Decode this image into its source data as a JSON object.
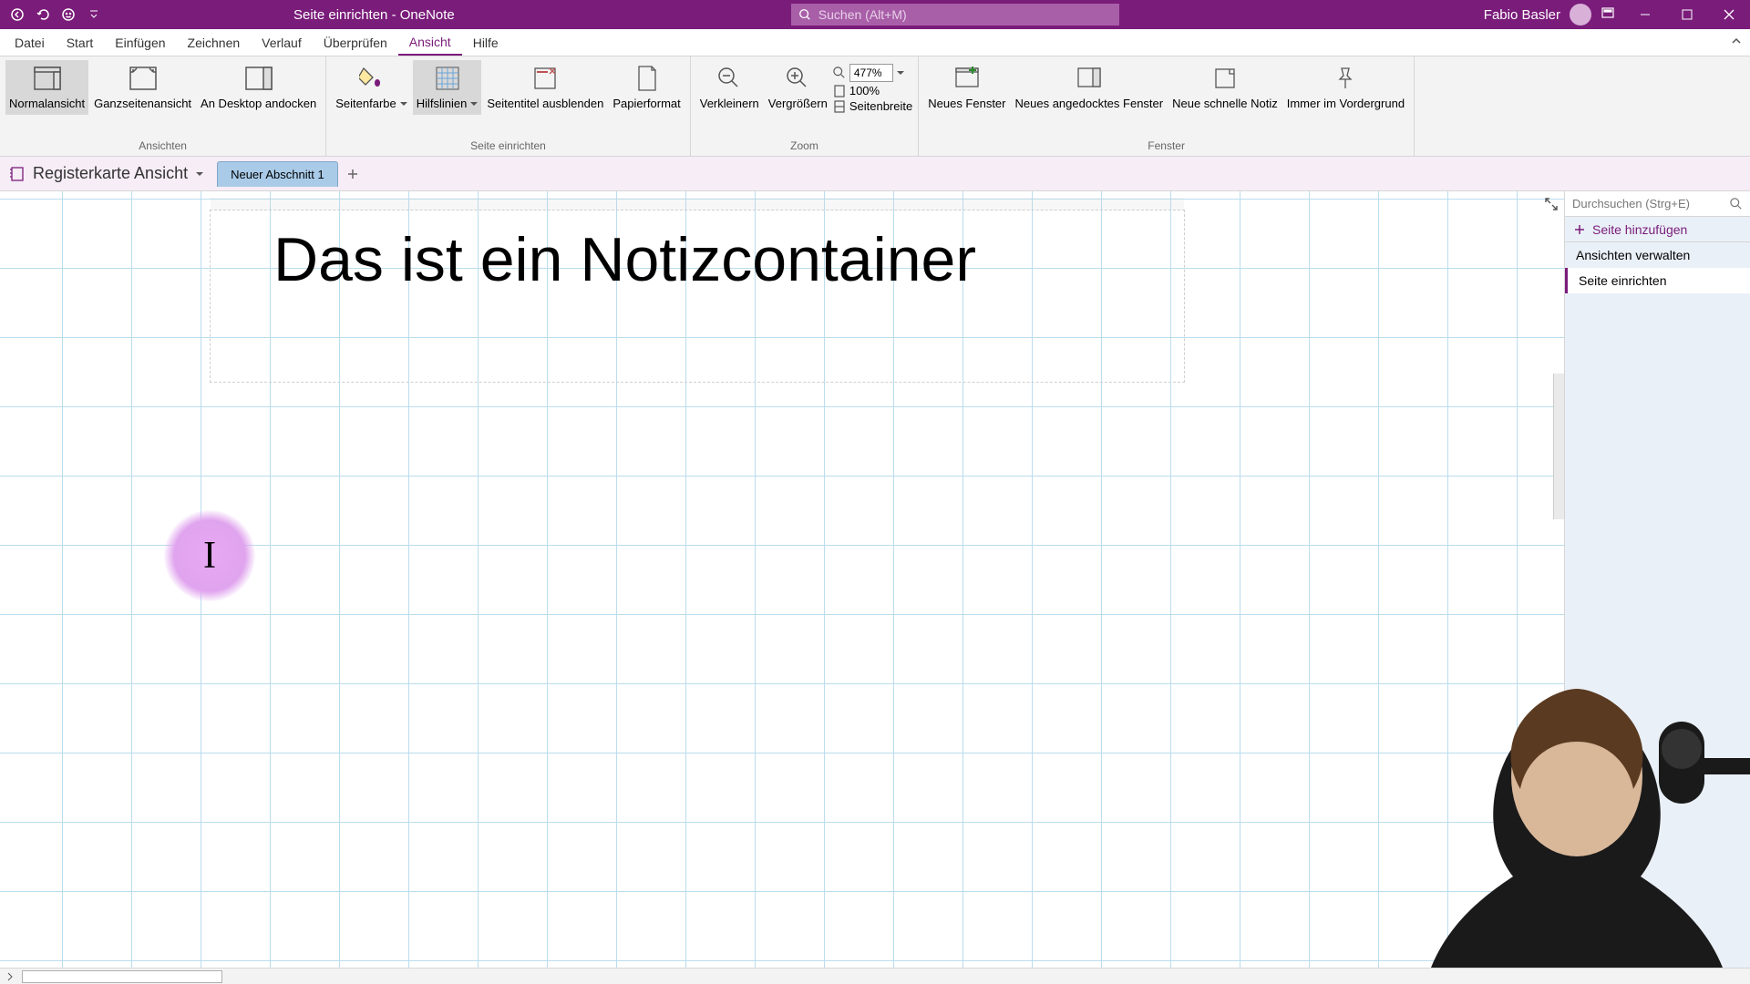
{
  "app": {
    "title": "Seite einrichten  -  OneNote",
    "user_name": "Fabio Basler",
    "search_placeholder": "Suchen (Alt+M)"
  },
  "menu": {
    "items": [
      "Datei",
      "Start",
      "Einfügen",
      "Zeichnen",
      "Verlauf",
      "Überprüfen",
      "Ansicht",
      "Hilfe"
    ],
    "active_index": 6
  },
  "ribbon": {
    "groups": {
      "ansichten": {
        "label": "Ansichten",
        "normal": "Normalansicht",
        "ganzseite": "Ganzseitenansicht",
        "andesktop": "An Desktop andocken"
      },
      "seite": {
        "label": "Seite einrichten",
        "seitenfarbe": "Seitenfarbe",
        "hilfslinien": "Hilfslinien",
        "seitentitel": "Seitentitel ausblenden",
        "papierformat": "Papierformat"
      },
      "zoom": {
        "label": "Zoom",
        "verkleinern": "Verkleinern",
        "vergroessern": "Vergrößern",
        "percent": "477%",
        "hundred": "100%",
        "seitenbreite": "Seitenbreite"
      },
      "fenster": {
        "label": "Fenster",
        "neues_fenster": "Neues Fenster",
        "neues_angedocktes": "Neues angedocktes Fenster",
        "neue_schnelle": "Neue schnelle Notiz",
        "immer_vg": "Immer im Vordergrund"
      }
    }
  },
  "notebook": {
    "name": "Registerkarte Ansicht",
    "section_tab": "Neuer Abschnitt 1"
  },
  "page": {
    "title_text": "Das ist ein Notizcontainer"
  },
  "pagepanel": {
    "search_placeholder": "Durchsuchen (Strg+E)",
    "add_page": "Seite hinzufügen",
    "items": [
      "Ansichten verwalten",
      "Seite einrichten"
    ],
    "selected_index": 1
  }
}
